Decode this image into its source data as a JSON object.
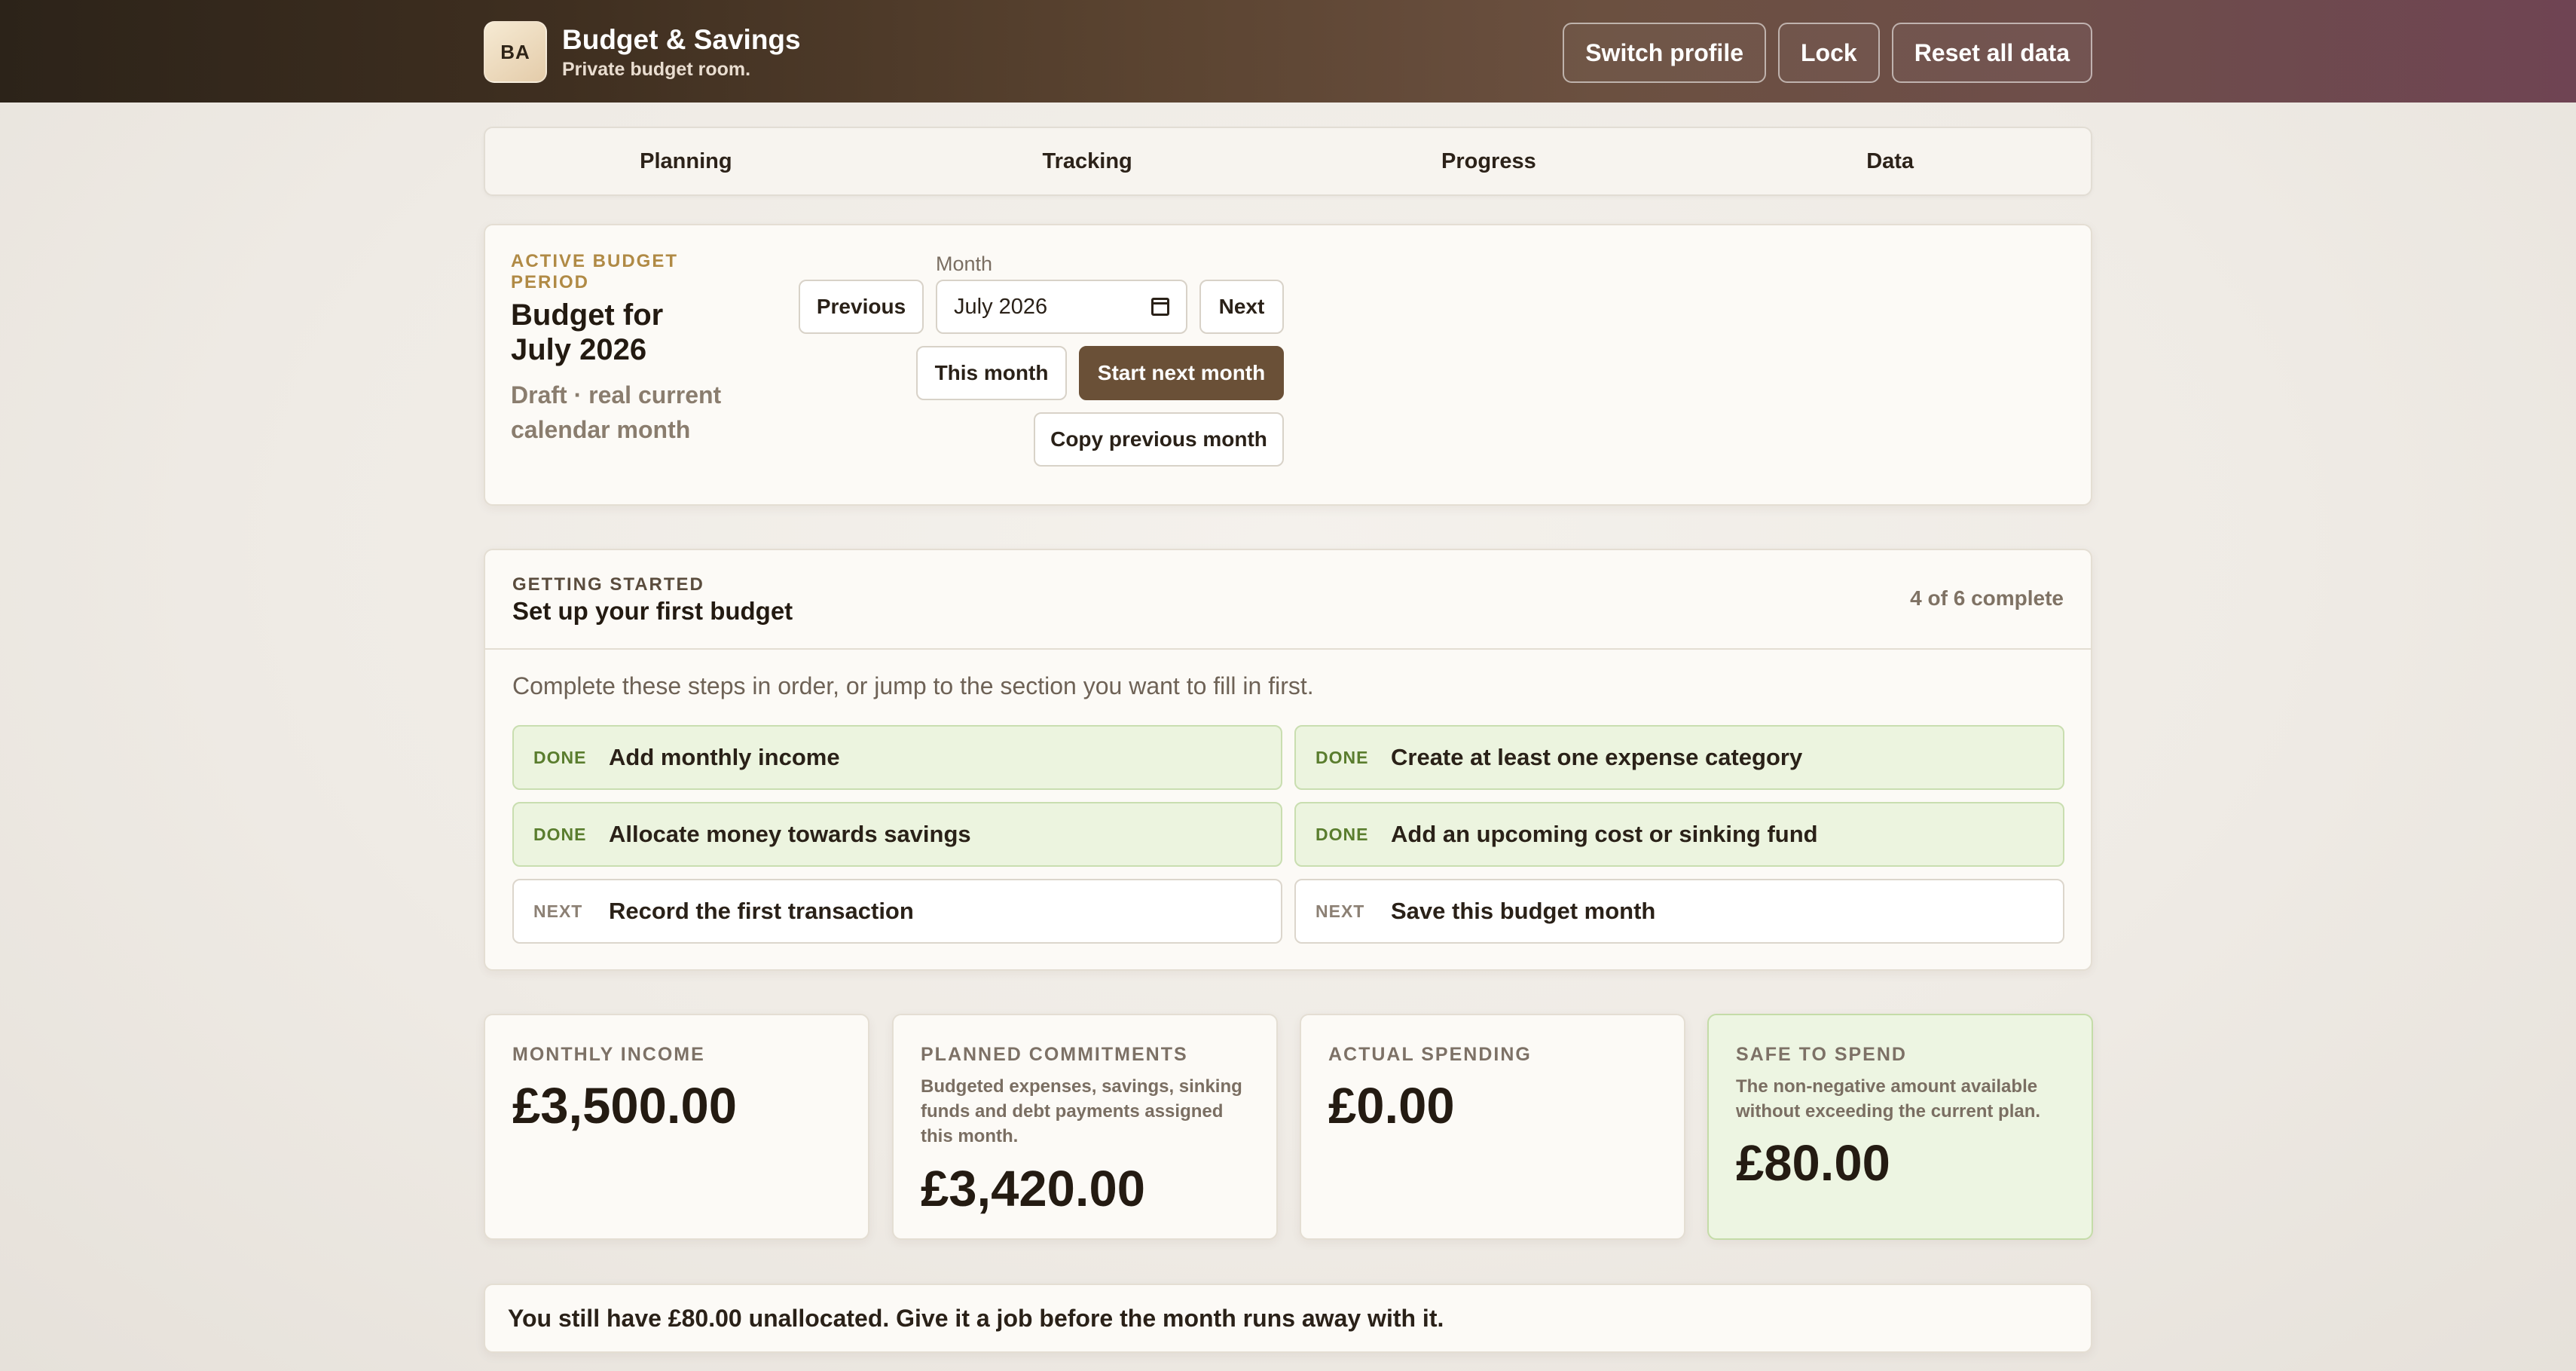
{
  "header": {
    "brand_initials": "BA",
    "title": "Budget & Savings",
    "subtitle": "Private budget room.",
    "actions": [
      "Switch profile",
      "Lock",
      "Reset all data"
    ]
  },
  "nav": {
    "tabs": [
      "Planning",
      "Tracking",
      "Progress",
      "Data"
    ]
  },
  "period": {
    "eyebrow": "ACTIVE BUDGET PERIOD",
    "title": "Budget for July 2026",
    "status": "Draft · real current calendar month",
    "previous_label": "Previous",
    "next_label": "Next",
    "month_label": "Month",
    "month_value": "July  2026",
    "this_month_label": "This month",
    "start_next_label": "Start next month",
    "copy_prev_label": "Copy previous month"
  },
  "getting_started": {
    "eyebrow": "GETTING STARTED",
    "title": "Set up your first budget",
    "progress": "4 of 6 complete",
    "description": "Complete these steps in order, or jump to the section you want to fill in first.",
    "steps": [
      {
        "tag": "DONE",
        "label": "Add monthly income",
        "status": "done"
      },
      {
        "tag": "DONE",
        "label": "Create at least one expense category",
        "status": "done"
      },
      {
        "tag": "DONE",
        "label": "Allocate money towards savings",
        "status": "done"
      },
      {
        "tag": "DONE",
        "label": "Add an upcoming cost or sinking fund",
        "status": "done"
      },
      {
        "tag": "NEXT",
        "label": "Record the first transaction",
        "status": "next"
      },
      {
        "tag": "NEXT",
        "label": "Save this budget month",
        "status": "next"
      }
    ]
  },
  "stats": {
    "income": {
      "label": "MONTHLY INCOME",
      "value": "£3,500.00"
    },
    "commitments": {
      "label": "PLANNED COMMITMENTS",
      "note": "Budgeted expenses, savings, sinking funds and debt payments assigned this month.",
      "value": "£3,420.00"
    },
    "spending": {
      "label": "ACTUAL SPENDING",
      "value": "£0.00"
    },
    "safe": {
      "label": "SAFE TO SPEND",
      "note": "The non-negative amount available without exceeding the current plan.",
      "value": "£80.00"
    }
  },
  "banner": {
    "text": "You still have £80.00 unallocated. Give it a job before the month runs away with it."
  },
  "colors": {
    "accent": "#6a5037",
    "done_bg": "#ecf4df",
    "done_text": "#5a7d2e",
    "eyebrow_gold": "#b08a45"
  }
}
